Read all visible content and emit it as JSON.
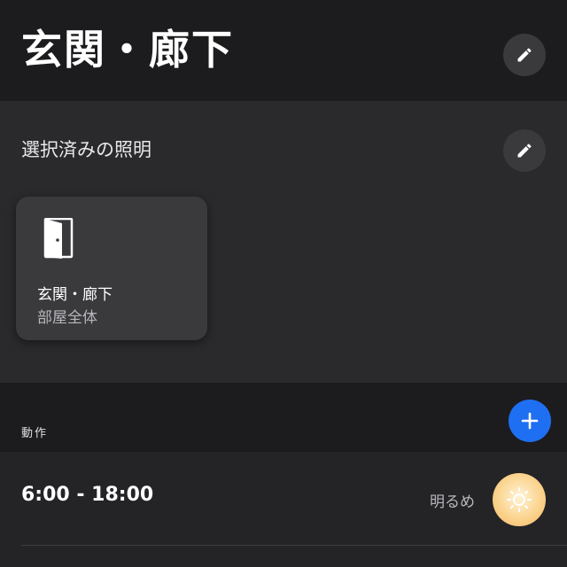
{
  "header": {
    "title": "玄関・廊下",
    "edit_icon": "pencil-icon"
  },
  "selected_lights": {
    "title": "選択済みの照明",
    "edit_icon": "pencil-icon",
    "cards": [
      {
        "icon": "door-icon",
        "name": "玄関・廊下",
        "subtitle": "部屋全体"
      }
    ]
  },
  "actions": {
    "label": "動作",
    "add_icon": "plus-icon",
    "add_color": "#1f6ff2",
    "items": [
      {
        "time": "6:00 - 18:00",
        "scene": "明るめ",
        "scene_icon": "sun-icon"
      }
    ]
  },
  "colors": {
    "background": "#1c1c1e",
    "section": "#2a2a2d",
    "card": "#3a3a3d"
  }
}
